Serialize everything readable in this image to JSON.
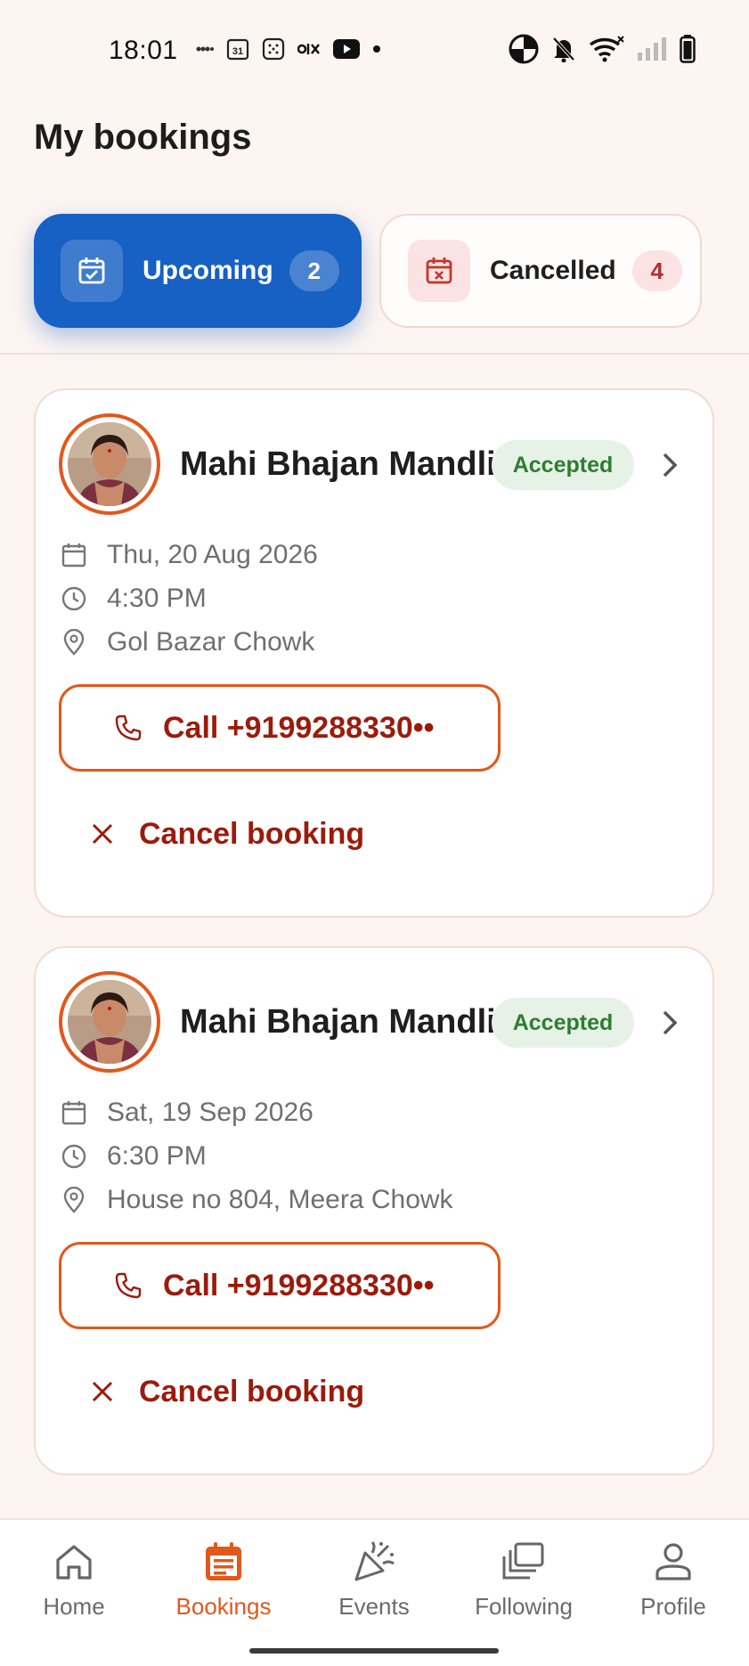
{
  "status_bar": {
    "time": "18:01",
    "left_icons": [
      "google-one-icon",
      "calendar-31-icon",
      "calculator-icon",
      "olx-icon",
      "youtube-icon",
      "dot-icon"
    ],
    "right_icons": [
      "data-saver-icon",
      "mute-bell-icon",
      "wifi-icon",
      "signal-icon",
      "battery-icon"
    ],
    "calendar_day": "31"
  },
  "header": {
    "title": "My bookings"
  },
  "tabs": [
    {
      "label": "Upcoming",
      "count": "2",
      "active": true,
      "icon": "calendar-check-icon"
    },
    {
      "label": "Cancelled",
      "count": "4",
      "active": false,
      "icon": "calendar-x-icon"
    }
  ],
  "bookings": [
    {
      "name": "Mahi Bhajan Mandli",
      "status": "Accepted",
      "date": "Thu, 20 Aug 2026",
      "time": "4:30 PM",
      "location": "Gol Bazar Chowk",
      "call_label": "Call +9199288330••",
      "cancel_label": "Cancel booking"
    },
    {
      "name": "Mahi Bhajan Mandli",
      "status": "Accepted",
      "date": "Sat, 19 Sep 2026",
      "time": "6:30 PM",
      "location": "House no 804, Meera Chowk",
      "call_label": "Call +9199288330••",
      "cancel_label": "Cancel booking"
    }
  ],
  "bottom_nav": [
    {
      "label": "Home",
      "icon": "home-icon",
      "active": false
    },
    {
      "label": "Bookings",
      "icon": "bookings-icon",
      "active": true
    },
    {
      "label": "Events",
      "icon": "party-popper-icon",
      "active": false
    },
    {
      "label": "Following",
      "icon": "stacked-cards-icon",
      "active": false
    },
    {
      "label": "Profile",
      "icon": "person-icon",
      "active": false
    }
  ],
  "colors": {
    "primary_blue": "#1760c4",
    "accent_orange": "#e1581b",
    "danger_red": "#9b1b0b",
    "success_green": "#2e7d32",
    "background": "#fdf5f2"
  }
}
